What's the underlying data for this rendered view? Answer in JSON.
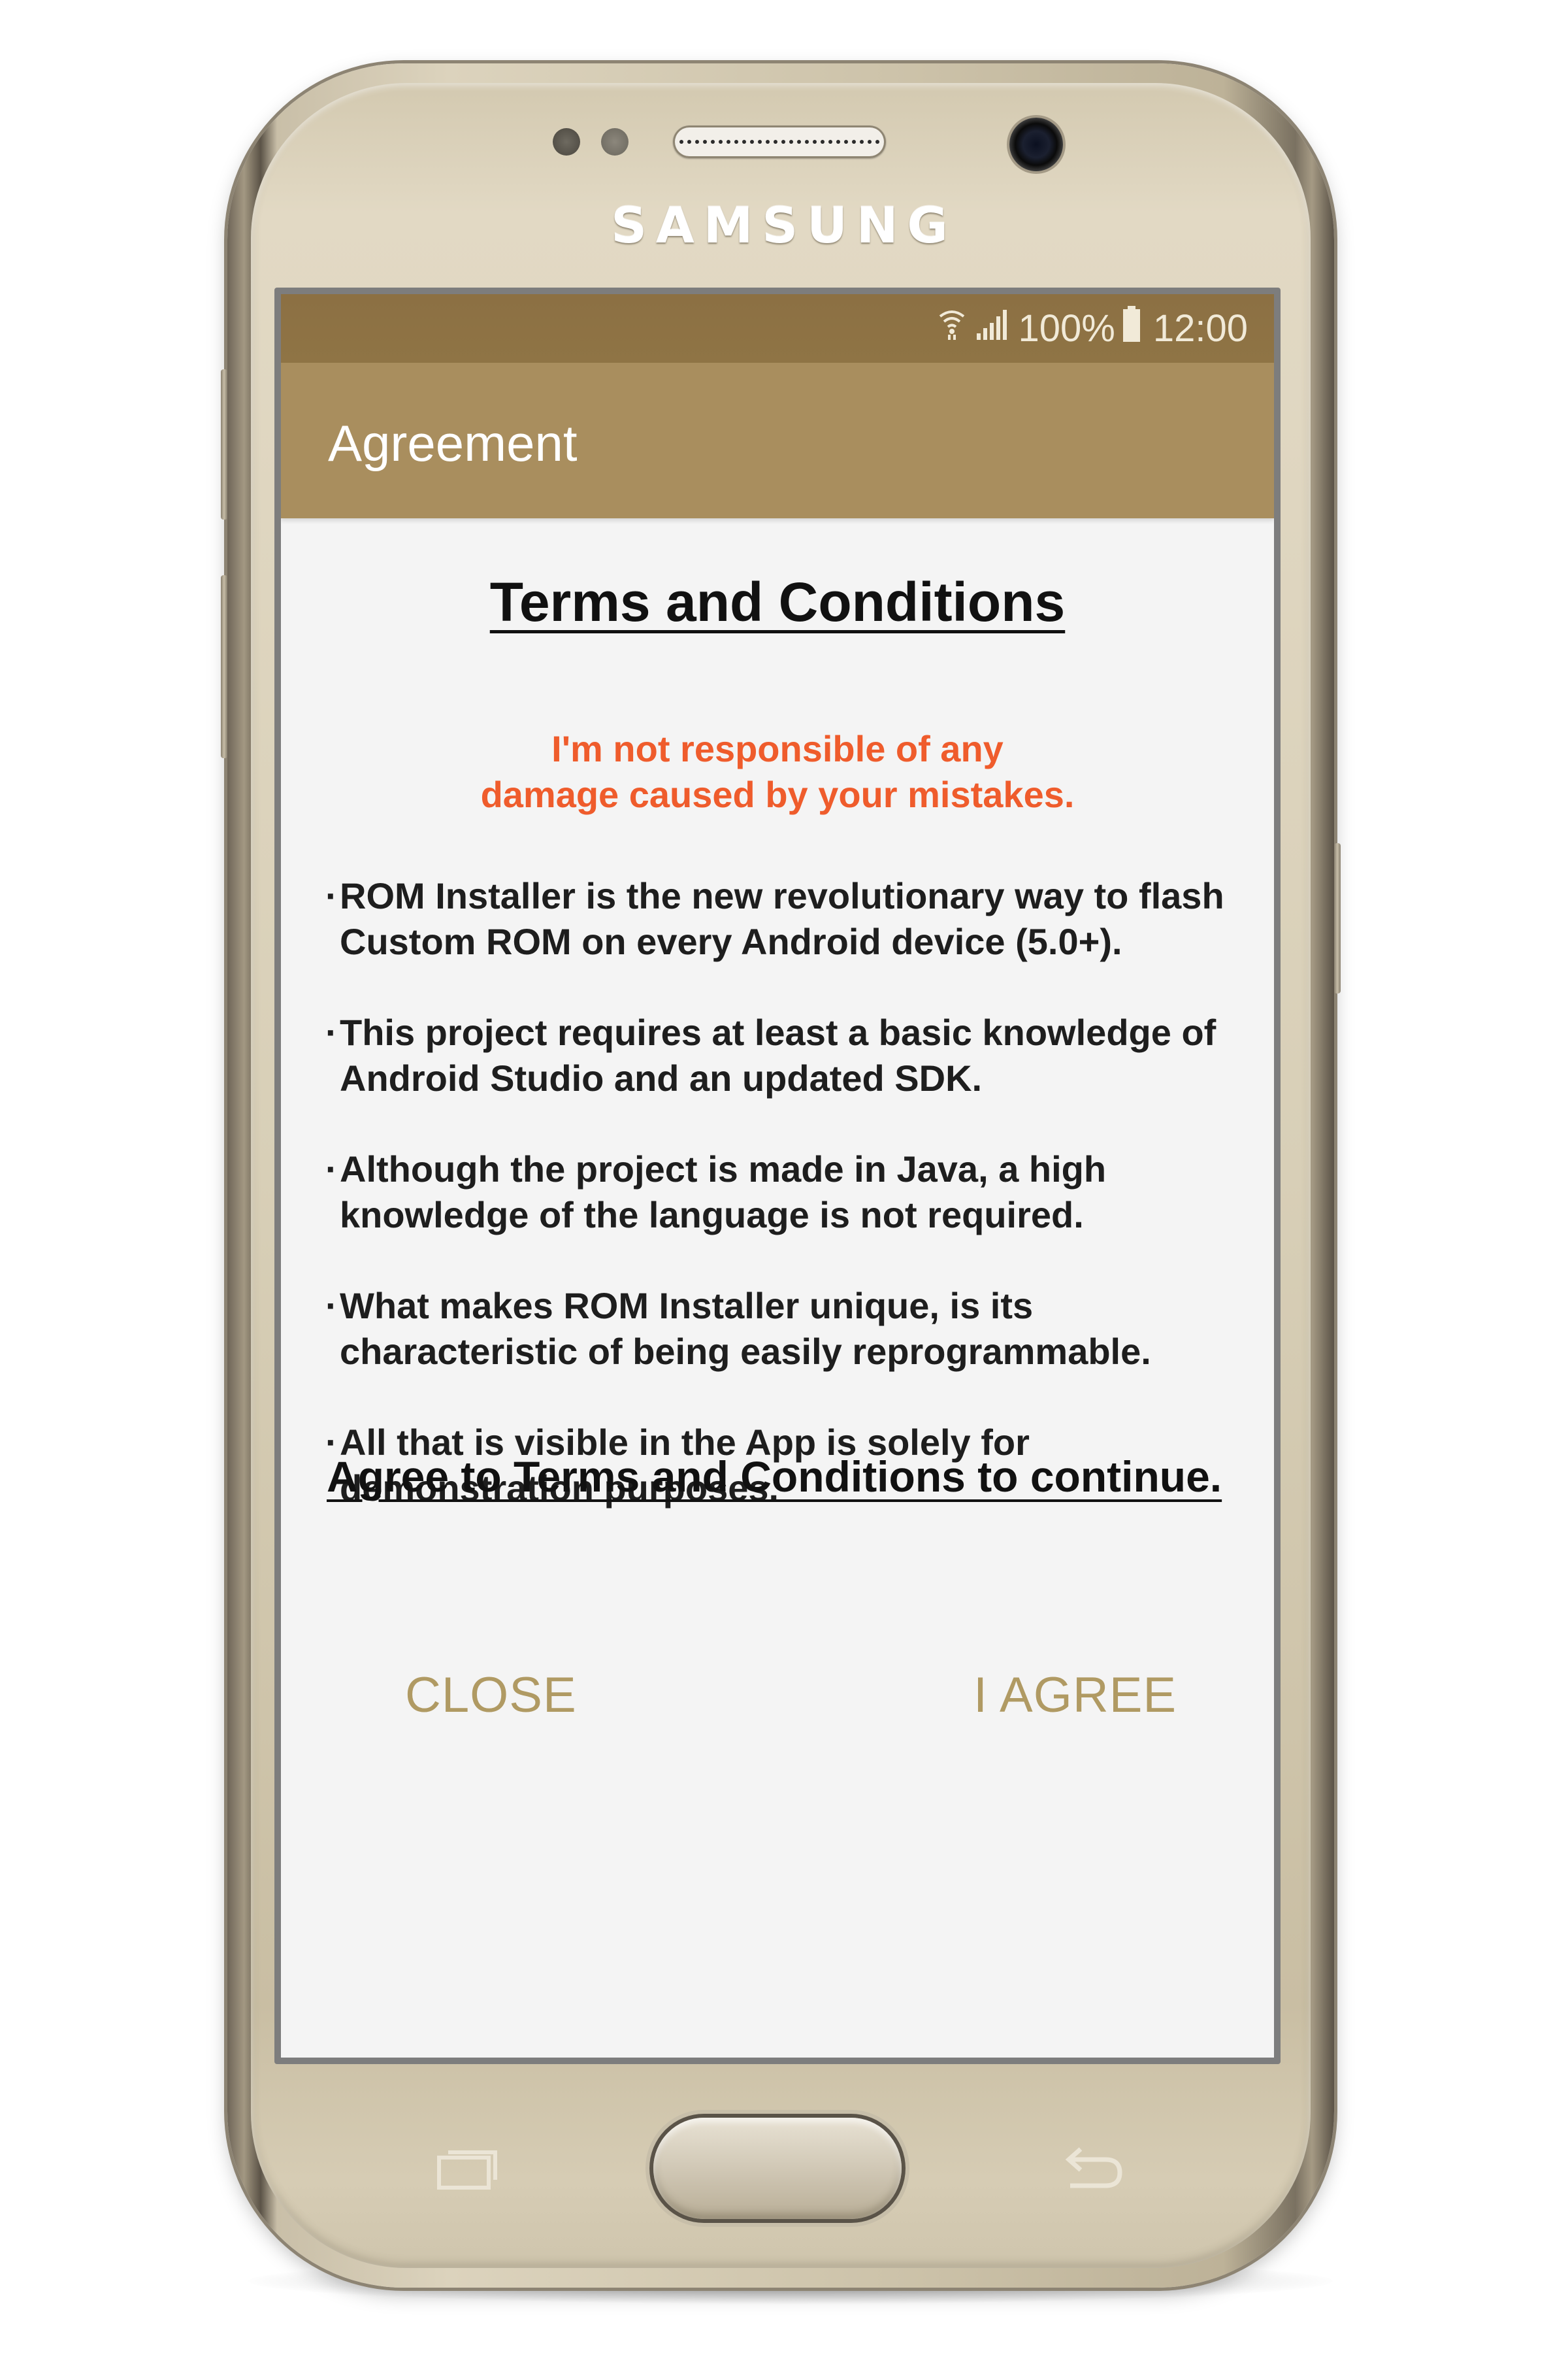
{
  "device": {
    "brand": "SAMSUNG"
  },
  "status_bar": {
    "battery": "100%",
    "time": "12:00",
    "icons": [
      "wifi-icon",
      "signal-icon",
      "battery-icon"
    ]
  },
  "app_bar": {
    "title": "Agreement"
  },
  "dialog": {
    "heading": "Terms and Conditions",
    "warning_line1": "I'm not responsible of any",
    "warning_line2": "damage caused by your mistakes.",
    "bullets": [
      {
        "line1": "ROM Installer is the new revolutionary way to flash",
        "line2": "Custom ROM on every Android device (5.0+)."
      },
      {
        "line1": "This project requires at least a basic knowledge of",
        "line2": "Android Studio and an updated SDK."
      },
      {
        "line1": "Although the project is made in Java, a high",
        "line2": "knowledge of the language is not required."
      },
      {
        "line1": "What makes ROM Installer unique, is its",
        "line2": "characteristic of being easily reprogrammable."
      },
      {
        "line1": "All that is visible in the App is solely for",
        "line2": "demonstration purposes."
      }
    ],
    "bullet_marker": "·",
    "agree_note": "Agree to Terms and Conditions to continue.",
    "close_label": "CLOSE",
    "agree_label": "I AGREE"
  },
  "colors": {
    "status_bar": "#8c7043",
    "app_bar": "#a98e5e",
    "warning_text": "#ef5c2c",
    "button_text": "#b09a63",
    "phone_gold": "#dcd3bd"
  }
}
